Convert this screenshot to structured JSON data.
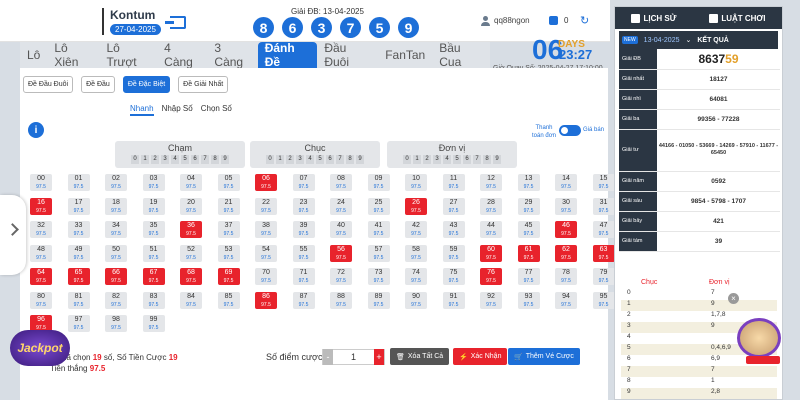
{
  "header": {
    "province": "Kontum",
    "date": "27-04-2025",
    "special_prize_label": "Giải ĐB: 13-04-2025",
    "balls": [
      "8",
      "6",
      "3",
      "7",
      "5",
      "9"
    ],
    "username": "qq88ngon",
    "balance": "0"
  },
  "tabs": [
    "Lô",
    "Lô Xiên",
    "Lô Trượt",
    "4 Càng",
    "3 Càng",
    "Đánh Đề",
    "Đầu Đuôi",
    "FanTan",
    "Bầu Cua"
  ],
  "active_tab": "Đánh Đề",
  "countdown": {
    "number": "06",
    "days_label": "DAYS",
    "time": "23:27",
    "draw_time": "Giờ Quay Số: 2025-04-27 17:10:00"
  },
  "subtabs": [
    "Đề Đầu Đuôi",
    "Đề Đầu",
    "Đề Đặc Biệt",
    "Đề Giải Nhất"
  ],
  "active_subtab": "Đề Đặc Biệt",
  "modes": [
    "Nhanh",
    "Nhập Số",
    "Chọn Số"
  ],
  "toggle": {
    "left": "Thanh toán đơn",
    "right": "Giá bán"
  },
  "filters": [
    {
      "title": "Chạm",
      "digits": [
        "0",
        "1",
        "2",
        "3",
        "4",
        "5",
        "6",
        "7",
        "8",
        "9"
      ]
    },
    {
      "title": "Chục",
      "digits": [
        "0",
        "1",
        "2",
        "3",
        "4",
        "5",
        "6",
        "7",
        "8",
        "9"
      ]
    },
    {
      "title": "Đơn vị",
      "digits": [
        "0",
        "1",
        "2",
        "3",
        "4",
        "5",
        "6",
        "7",
        "8",
        "9"
      ]
    }
  ],
  "odds": "97.5",
  "selected_numbers": [
    "06",
    "16",
    "26",
    "36",
    "46",
    "56",
    "60",
    "61",
    "62",
    "63",
    "64",
    "65",
    "66",
    "67",
    "68",
    "69",
    "76",
    "86",
    "96"
  ],
  "badge_79": "1",
  "footer": {
    "summary_prefix": "Số đã chọn",
    "count": "19",
    "summary_suffix": "số,",
    "stake_label": "Số Tiền Cược",
    "stake": "19",
    "win_label": "Tiền thắng",
    "win": "97.5",
    "points_label": "Số điểm cược",
    "points_value": "1",
    "clear": "Xóa Tất Cả",
    "confirm": "Xác Nhận",
    "add": "Thêm Vé Cược",
    "minus": "-",
    "plus": "+"
  },
  "side": {
    "history": "LỊCH SỬ",
    "rules": "LUẬT CHƠI",
    "new": "NEW",
    "date": "13-04-2025",
    "title": "KẾT QUẢ",
    "results": [
      {
        "label": "Giải ĐB",
        "value": "8637",
        "value_hl": "59"
      },
      {
        "label": "Giải nhất",
        "value": "18127"
      },
      {
        "label": "Giải nhì",
        "value": "64081"
      },
      {
        "label": "Giải ba",
        "value": "99356 - 77228"
      },
      {
        "label": "Giải tư",
        "value": "44166 - 01050 - 53669 - 14269 - 57910 - 11677 - 65450"
      },
      {
        "label": "Giải năm",
        "value": "0592"
      },
      {
        "label": "Giải sáu",
        "value": "9854 - 5798 - 1707"
      },
      {
        "label": "Giải bảy",
        "value": "421"
      },
      {
        "label": "Giải tám",
        "value": "39"
      }
    ],
    "loto_head": {
      "chuc": "Chục",
      "donvi": "Đơn vị"
    },
    "loto": [
      {
        "d": "0",
        "u": "7"
      },
      {
        "d": "1",
        "u": "9"
      },
      {
        "d": "2",
        "u": "1,7,8"
      },
      {
        "d": "3",
        "u": "9"
      },
      {
        "d": "4",
        "u": ""
      },
      {
        "d": "5",
        "u": "0,4,6,9"
      },
      {
        "d": "6",
        "u": "6,9"
      },
      {
        "d": "7",
        "u": "7"
      },
      {
        "d": "8",
        "u": "1"
      },
      {
        "d": "9",
        "u": "2,8"
      }
    ]
  }
}
